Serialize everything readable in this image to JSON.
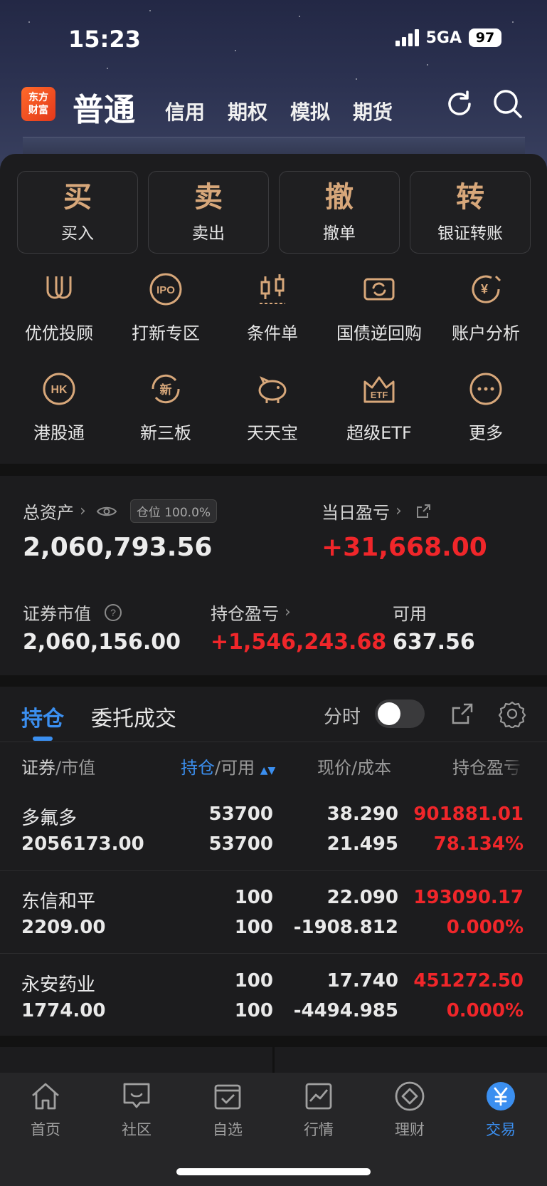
{
  "status": {
    "time": "15:23",
    "network": "5GA",
    "battery": "97"
  },
  "header": {
    "logo_line1": "东方",
    "logo_line2": "财富",
    "active_tab": "普通",
    "tabs": [
      "信用",
      "期权",
      "模拟",
      "期货"
    ],
    "icons": [
      "refresh-icon",
      "search-icon"
    ]
  },
  "quick_actions": [
    {
      "big": "买",
      "label": "买入"
    },
    {
      "big": "卖",
      "label": "卖出"
    },
    {
      "big": "撤",
      "label": "撤单"
    },
    {
      "big": "转",
      "label": "银证转账"
    }
  ],
  "grid_row1": [
    "优优投顾",
    "打新专区",
    "条件单",
    "国债逆回购",
    "账户分析"
  ],
  "grid_row2": [
    "港股通",
    "新三板",
    "天天宝",
    "超级ETF",
    "更多"
  ],
  "grid_icon_text": {
    "ipo": "IPO",
    "hk": "HK",
    "new": "新",
    "etf": "ETF",
    "yen": "¥"
  },
  "assets": {
    "total_label": "总资产",
    "position_badge": "仓位 100.0%",
    "total_value": "2,060,793.56",
    "daily_pl_label": "当日盈亏",
    "daily_pl_value": "+31,668.00",
    "market_value_label": "证券市值",
    "market_value": "2,060,156.00",
    "holding_pl_label": "持仓盈亏",
    "holding_pl_value": "+1,546,243.68",
    "available_label": "可用",
    "available_value": "637.56"
  },
  "holdings": {
    "tab_active": "持仓",
    "tab_other": "委托成交",
    "toggle_label": "分时",
    "toggle_on": false,
    "col_security": "证券",
    "col_mv": "/市值",
    "col_hold": "持仓",
    "col_avail": "/可用",
    "col_price": "现价/成本",
    "col_pl": "持仓盈亏",
    "rows": [
      {
        "name": "多氟多",
        "mv": "2056173.00",
        "hold": "53700",
        "avail": "53700",
        "price": "38.290",
        "cost": "21.495",
        "pl": "901881.01",
        "pl_pct": "78.134%"
      },
      {
        "name": "东信和平",
        "mv": "2209.00",
        "hold": "100",
        "avail": "100",
        "price": "22.090",
        "cost": "-1908.812",
        "pl": "193090.17",
        "pl_pct": "0.000%"
      },
      {
        "name": "永安药业",
        "mv": "1774.00",
        "hold": "100",
        "avail": "100",
        "price": "17.740",
        "cost": "-4494.985",
        "pl": "451272.50",
        "pl_pct": "0.000%"
      }
    ]
  },
  "tabbar": [
    {
      "label": "首页",
      "icon": "home-icon"
    },
    {
      "label": "社区",
      "icon": "community-icon"
    },
    {
      "label": "自选",
      "icon": "watchlist-icon"
    },
    {
      "label": "行情",
      "icon": "market-icon"
    },
    {
      "label": "理财",
      "icon": "wealth-icon"
    },
    {
      "label": "交易",
      "icon": "trade-icon",
      "active": true
    }
  ],
  "colors": {
    "accent": "#3b8ff0",
    "gain": "#f0262a",
    "gold": "#d7a77a"
  }
}
